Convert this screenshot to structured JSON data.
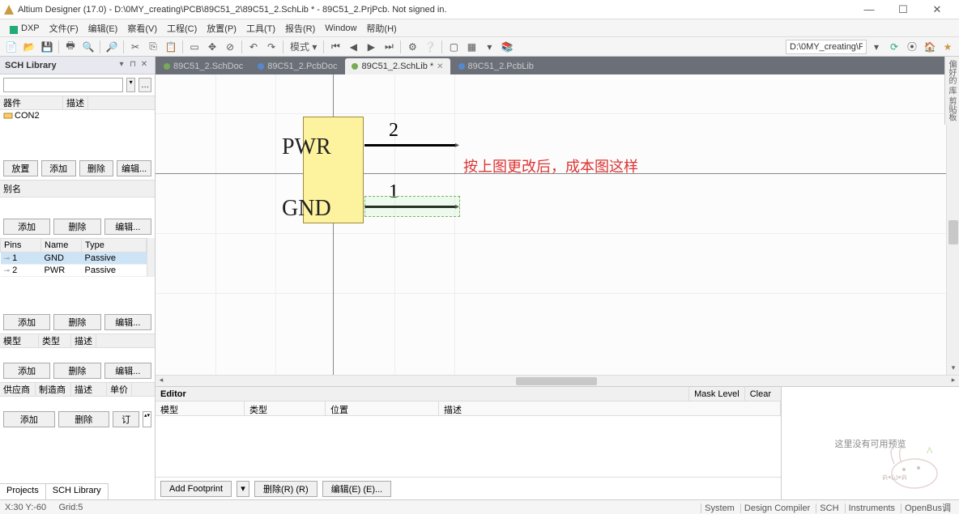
{
  "title": "Altium Designer (17.0) - D:\\0MY_creating\\PCB\\89C51_2\\89C51_2.SchLib * - 89C51_2.PrjPcb. Not signed in.",
  "menu": {
    "dxp": "DXP",
    "file": "文件(F)",
    "edit": "编辑(E)",
    "view": "察看(V)",
    "project": "工程(C)",
    "place": "放置(P)",
    "tools": "工具(T)",
    "report": "报告(R)",
    "window": "Window",
    "help": "帮助(H)"
  },
  "toolbar": {
    "mode": "模式 ▾",
    "right_path": "D:\\0MY_creating\\PCB\\89"
  },
  "sidebar": {
    "panel_title": "SCH Library",
    "cols": {
      "a": "器件",
      "b": "描述"
    },
    "item1": "CON2",
    "btns": {
      "place": "放置",
      "add": "添加",
      "del": "删除",
      "edit": "编辑..."
    },
    "alias": "别名",
    "btns2": {
      "add": "添加",
      "del": "删除",
      "edit": "编辑..."
    },
    "pins": {
      "h1": "Pins",
      "h2": "Name",
      "h3": "Type",
      "r1": {
        "pin": "1",
        "name": "GND",
        "type": "Passive"
      },
      "r2": {
        "pin": "2",
        "name": "PWR",
        "type": "Passive"
      }
    },
    "btns3": {
      "add": "添加",
      "del": "删除",
      "edit": "编辑..."
    },
    "model_cols": {
      "a": "模型",
      "b": "类型",
      "c": "描述"
    },
    "btns4": {
      "add": "添加",
      "del": "删除",
      "edit": "编辑..."
    },
    "supply_cols": {
      "a": "供应商",
      "b": "制造商",
      "c": "描述",
      "d": "单价"
    },
    "btns5": {
      "add": "添加",
      "del": "删除",
      "order": "订"
    }
  },
  "tabs": {
    "t1": "89C51_2.SchDoc",
    "t2": "89C51_2.PcbDoc",
    "t3": "89C51_2.SchLib *",
    "t4": "89C51_2.PcbLib"
  },
  "canvas": {
    "pwr": "PWR",
    "gnd": "GND",
    "pin1": "1",
    "pin2": "2",
    "note": "按上图更改后，成本图这样"
  },
  "editor": {
    "title": "Editor",
    "mask": "Mask Level",
    "clear": "Clear",
    "cols": {
      "a": "模型",
      "b": "类型",
      "c": "位置",
      "d": "描述"
    },
    "foot": {
      "add": "Add Footprint",
      "del": "删除(R) (R)",
      "edit": "编辑(E) (E)..."
    },
    "preview": "这里没有可用预览"
  },
  "bottom_tabs": {
    "a": "Projects",
    "b": "SCH Library"
  },
  "status": {
    "coords": "X:30 Y:-60",
    "grid": "Grid:5",
    "links": {
      "a": "System",
      "b": "Design Compiler",
      "c": "SCH",
      "d": "Instruments",
      "e": "OpenBus调"
    }
  },
  "vert": "偏好的 库 剪贴板"
}
